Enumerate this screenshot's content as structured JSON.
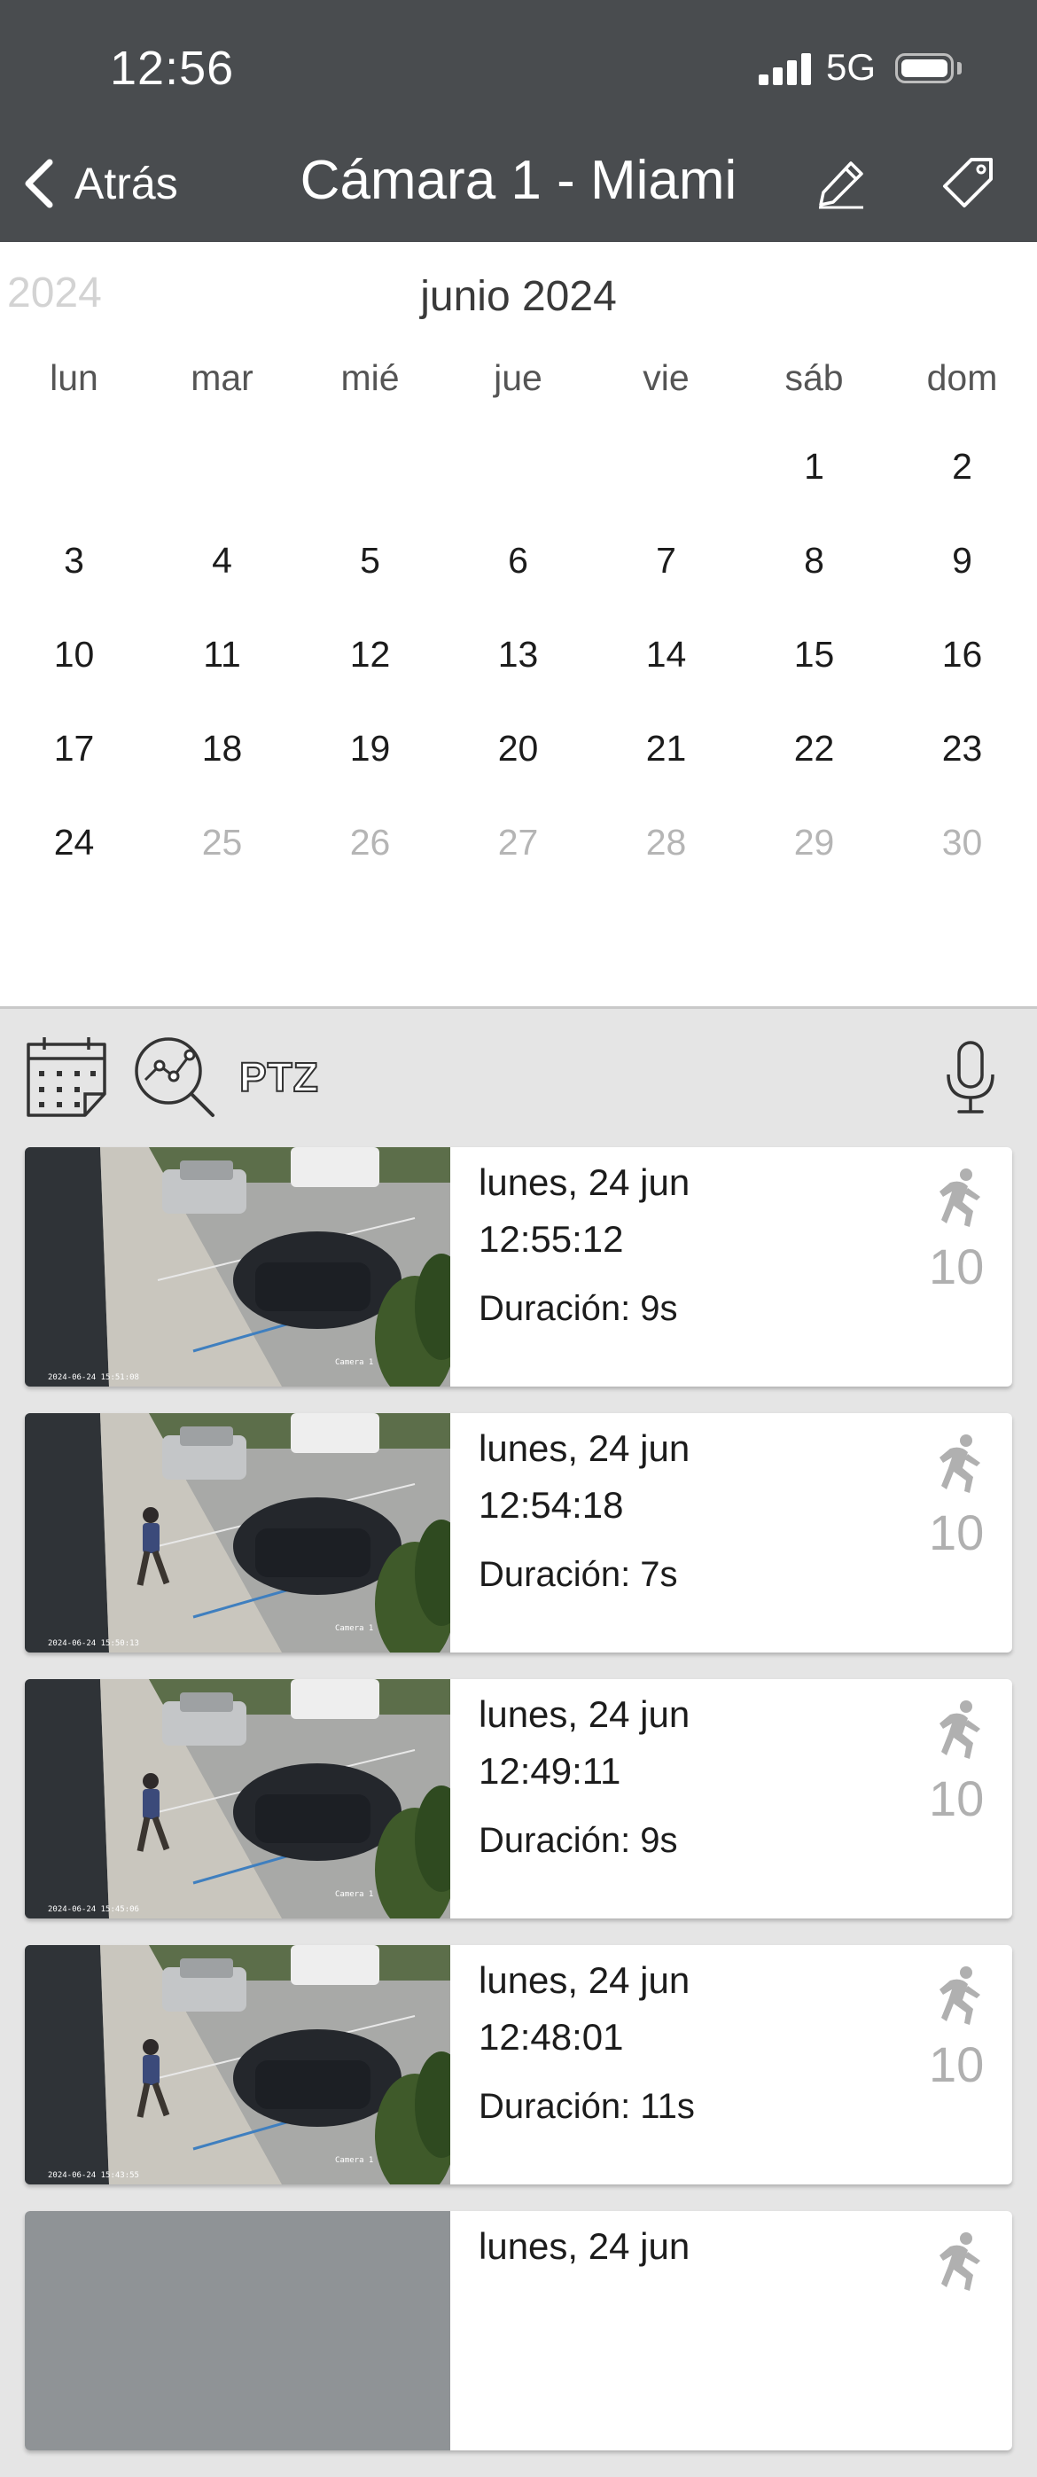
{
  "status_bar": {
    "time": "12:56",
    "network": "5G"
  },
  "nav": {
    "back_label": "Atrás",
    "title": "Cámara 1 - Miami"
  },
  "calendar": {
    "year_label": "2024",
    "month_label": "junio 2024",
    "weekdays": [
      "lun",
      "mar",
      "mié",
      "jue",
      "vie",
      "sáb",
      "dom"
    ],
    "weeks": [
      [
        {
          "d": ""
        },
        {
          "d": ""
        },
        {
          "d": ""
        },
        {
          "d": ""
        },
        {
          "d": ""
        },
        {
          "d": "1"
        },
        {
          "d": "2"
        }
      ],
      [
        {
          "d": "3"
        },
        {
          "d": "4"
        },
        {
          "d": "5"
        },
        {
          "d": "6"
        },
        {
          "d": "7"
        },
        {
          "d": "8"
        },
        {
          "d": "9"
        }
      ],
      [
        {
          "d": "10"
        },
        {
          "d": "11"
        },
        {
          "d": "12"
        },
        {
          "d": "13"
        },
        {
          "d": "14"
        },
        {
          "d": "15"
        },
        {
          "d": "16"
        }
      ],
      [
        {
          "d": "17"
        },
        {
          "d": "18"
        },
        {
          "d": "19"
        },
        {
          "d": "20"
        },
        {
          "d": "21"
        },
        {
          "d": "22"
        },
        {
          "d": "23"
        }
      ],
      [
        {
          "d": "24"
        },
        {
          "d": "25",
          "muted": true
        },
        {
          "d": "26",
          "muted": true
        },
        {
          "d": "27",
          "muted": true
        },
        {
          "d": "28",
          "muted": true
        },
        {
          "d": "29",
          "muted": true
        },
        {
          "d": "30",
          "muted": true
        }
      ]
    ]
  },
  "toolbar": {
    "ptz_label": "PTZ"
  },
  "events": [
    {
      "date": "lunes, 24 jun",
      "time": "12:55:12",
      "duration": "Duración: 9s",
      "count": "10",
      "overlay_timestamp": "2024-06-24 15:51:08",
      "overlay_camera": "Camera 1",
      "person": false
    },
    {
      "date": "lunes, 24 jun",
      "time": "12:54:18",
      "duration": "Duración: 7s",
      "count": "10",
      "overlay_timestamp": "2024-06-24 15:50:13",
      "overlay_camera": "Camera 1",
      "person": true
    },
    {
      "date": "lunes, 24 jun",
      "time": "12:49:11",
      "duration": "Duración: 9s",
      "count": "10",
      "overlay_timestamp": "2024-06-24 15:45:06",
      "overlay_camera": "Camera 1",
      "person": true
    },
    {
      "date": "lunes, 24 jun",
      "time": "12:48:01",
      "duration": "Duración: 11s",
      "count": "10",
      "overlay_timestamp": "2024-06-24 15:43:55",
      "overlay_camera": "Camera 1",
      "person": true
    },
    {
      "date": "lunes, 24 jun",
      "time": "",
      "duration": "",
      "count": "",
      "overlay_timestamp": "",
      "overlay_camera": "",
      "person": false
    }
  ],
  "colors": {
    "header_bg": "#494c4f",
    "muted_day": "#b5b5b5",
    "count_gray": "#b0b0b0"
  }
}
